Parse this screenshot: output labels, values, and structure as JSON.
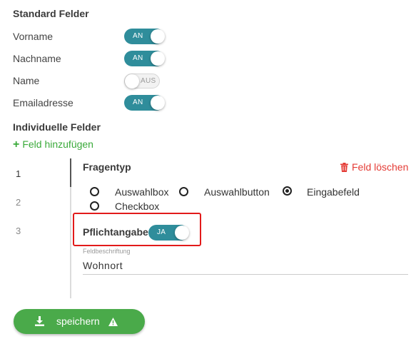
{
  "standard": {
    "heading": "Standard Felder",
    "fields": [
      {
        "label": "Vorname",
        "toggle": "AN",
        "on": true
      },
      {
        "label": "Nachname",
        "toggle": "AN",
        "on": true
      },
      {
        "label": "Name",
        "toggle": "AUS",
        "on": false
      },
      {
        "label": "Emailadresse",
        "toggle": "AN",
        "on": true
      }
    ]
  },
  "individual": {
    "heading": "Individuelle Felder",
    "add_label": "Feld hinzufügen",
    "numbers": [
      "1",
      "2",
      "3"
    ]
  },
  "question": {
    "title": "Fragentyp",
    "delete_label": "Feld löschen",
    "options": [
      "Auswahlbox",
      "Auswahlbutton",
      "Eingabefeld",
      "Checkbox"
    ],
    "selected": "Eingabefeld",
    "required_label": "Pflichtangabe",
    "required_toggle": "JA",
    "field_caption": "Feldbeschriftung",
    "field_value": "Wohnort"
  },
  "save_label": "speichern",
  "colors": {
    "toggle_on": "#2f8d9b",
    "green": "#4aaa4a",
    "red": "#e43b35",
    "highlight": "#e21a1a"
  }
}
